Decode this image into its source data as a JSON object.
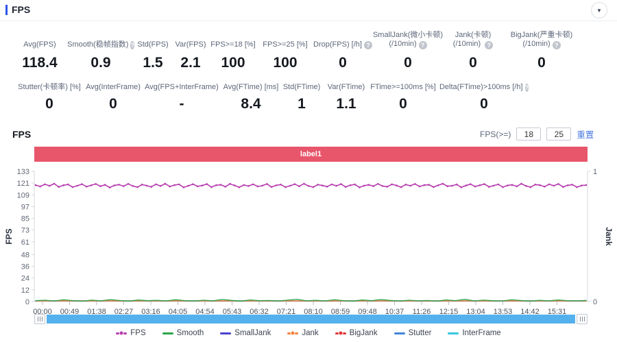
{
  "header": {
    "title": "FPS",
    "collapse_glyph": "▼",
    "accent_color": "#2f54eb"
  },
  "ui": {
    "help_glyph": "?"
  },
  "stats": {
    "row1": [
      {
        "label": "Avg(FPS)",
        "value": "118.4"
      },
      {
        "label": "Smooth(稳帧指数)",
        "value": "0.9",
        "help": true
      },
      {
        "label": "Std(FPS)",
        "value": "1.5"
      },
      {
        "label": "Var(FPS)",
        "value": "2.1"
      },
      {
        "label": "FPS>=18 [%]",
        "value": "100"
      },
      {
        "label": "FPS>=25 [%]",
        "value": "100"
      },
      {
        "label": "Drop(FPS) [/h]",
        "value": "0",
        "help": true
      },
      {
        "label": "SmallJank(微小卡顿)",
        "label2": "(/10min)",
        "value": "0",
        "help": true
      },
      {
        "label": "Jank(卡顿)",
        "label2": "(/10min)",
        "value": "0",
        "help": true
      },
      {
        "label": "BigJank(严重卡顿)",
        "label2": "(/10min)",
        "value": "0",
        "help": true
      }
    ],
    "row2": [
      {
        "label": "Stutter(卡顿率) [%]",
        "value": "0"
      },
      {
        "label": "Avg(InterFrame)",
        "value": "0"
      },
      {
        "label": "Avg(FPS+InterFrame)",
        "value": "-"
      },
      {
        "label": "Avg(FTime) [ms]",
        "value": "8.4"
      },
      {
        "label": "Std(FTime)",
        "value": "1"
      },
      {
        "label": "Var(FTime)",
        "value": "1.1"
      },
      {
        "label": "FTime>=100ms [%]",
        "value": "0"
      },
      {
        "label": "Delta(FTime)>100ms [/h]",
        "value": "0",
        "help": true
      }
    ]
  },
  "section": {
    "title": "FPS"
  },
  "controls": {
    "fps_ge_label": "FPS(>=)",
    "fps_min": "18",
    "fps_max": "25",
    "reset_label": "重置",
    "link_color": "#4a7ae0"
  },
  "banner": {
    "text": "label1",
    "color": "#e8566b"
  },
  "scrollbar": {
    "color": "#55b1ee"
  },
  "chart_data": {
    "type": "line",
    "title": "label1",
    "x_ticks": [
      "00:00",
      "00:49",
      "01:38",
      "02:27",
      "03:16",
      "04:05",
      "04:54",
      "05:43",
      "06:32",
      "07:21",
      "08:10",
      "08:59",
      "09:48",
      "10:37",
      "11:26",
      "12:15",
      "13:04",
      "13:53",
      "14:42",
      "15:31"
    ],
    "y_left": {
      "label": "FPS",
      "ticks": [
        0,
        12,
        24,
        36,
        48,
        61,
        73,
        85,
        97,
        109,
        121,
        133
      ],
      "max": 133
    },
    "y_right": {
      "label": "Jank",
      "ticks": [
        0,
        1
      ],
      "max": 1
    },
    "grid": false,
    "legend_position": "bottom",
    "series": [
      {
        "name": "SmallJank",
        "color": "#4a43ce",
        "axis": "right",
        "marker": false,
        "values": [
          0
        ]
      },
      {
        "name": "Stutter",
        "color": "#4285d7",
        "axis": "right",
        "marker": false,
        "values": [
          0
        ]
      },
      {
        "name": "InterFrame",
        "color": "#35c8e0",
        "axis": "right",
        "marker": false,
        "values": [
          0
        ]
      },
      {
        "name": "BigJank",
        "color": "#e13536",
        "axis": "right",
        "marker": true,
        "values": [
          0
        ]
      },
      {
        "name": "Jank",
        "color": "#f5833c",
        "axis": "right",
        "marker": true,
        "values": [
          0
        ]
      },
      {
        "name": "Smooth",
        "color": "#2da44a",
        "axis": "left",
        "marker": false,
        "values": [
          0.9,
          1.4,
          0.6,
          1.8,
          1.0,
          0.4,
          1.5,
          0.8,
          2.0,
          1.1,
          0.5,
          1.6,
          0.9,
          1.3,
          0.7,
          1.9,
          1.0,
          0.6,
          1.4,
          0.8,
          2.2,
          1.2,
          0.5,
          1.7,
          0.9,
          1.1,
          0.6,
          1.5,
          2.4,
          0.8,
          1.3,
          0.7,
          1.8,
          1.0,
          0.5,
          1.6,
          0.9,
          2.1,
          1.2,
          0.6,
          1.4,
          0.8,
          1.1,
          0.5,
          1.7,
          1.0,
          2.3,
          0.7,
          1.5,
          0.9,
          0.6,
          1.8,
          1.1,
          0.5,
          1.3,
          0.8,
          1.6,
          1.0,
          0.7,
          1.2
        ]
      },
      {
        "name": "FPS",
        "color": "#b73baf",
        "axis": "left",
        "marker": true,
        "values": [
          118.9,
          117.6,
          119.8,
          118.2,
          120.4,
          117.1,
          118.8,
          119.6,
          116.9,
          118.3,
          119.9,
          117.4,
          118.7,
          120.1,
          117.8,
          119.2,
          116.5,
          118.6,
          119.4,
          117.9,
          120.2,
          118.1,
          116.8,
          119.5,
          118.4,
          117.2,
          119.8,
          118.0,
          120.3,
          117.5,
          118.9,
          119.7,
          116.6,
          118.2,
          119.9,
          117.7,
          118.5,
          120.0,
          116.9,
          118.8,
          119.3,
          117.3,
          120.2,
          118.6,
          116.7,
          119.1,
          118.0,
          119.8,
          117.6,
          118.4,
          120.1,
          117.0,
          118.7,
          119.5,
          116.8,
          118.3,
          119.9,
          117.8,
          120.3,
          118.1,
          116.9,
          119.4,
          118.5,
          117.4,
          119.7,
          118.2,
          120.0,
          117.1,
          118.8,
          119.6,
          116.6,
          118.4,
          119.2,
          117.9,
          120.2,
          118.0,
          117.3,
          119.8,
          118.6,
          116.8,
          119.5,
          118.3,
          120.1,
          117.6,
          118.9,
          119.3,
          117.0,
          118.7,
          120.4,
          117.8,
          118.2,
          119.6,
          116.7,
          118.5,
          119.9,
          117.5,
          118.8,
          120.0,
          117.2,
          118.4,
          119.7,
          116.9,
          118.6,
          119.2,
          117.7,
          120.3,
          118.1,
          116.8,
          119.5,
          118.9,
          117.4,
          119.8,
          118.3,
          120.1,
          117.1,
          118.7,
          119.4,
          116.9,
          118.5,
          119.0
        ]
      }
    ]
  },
  "legend": [
    {
      "label": "FPS",
      "color": "#b73baf",
      "marker": true
    },
    {
      "label": "Smooth",
      "color": "#2da44a",
      "marker": false
    },
    {
      "label": "SmallJank",
      "color": "#4a43ce",
      "marker": false
    },
    {
      "label": "Jank",
      "color": "#f5833c",
      "marker": true
    },
    {
      "label": "BigJank",
      "color": "#e13536",
      "marker": true
    },
    {
      "label": "Stutter",
      "color": "#4285d7",
      "marker": false
    },
    {
      "label": "InterFrame",
      "color": "#35c8e0",
      "marker": false
    }
  ]
}
